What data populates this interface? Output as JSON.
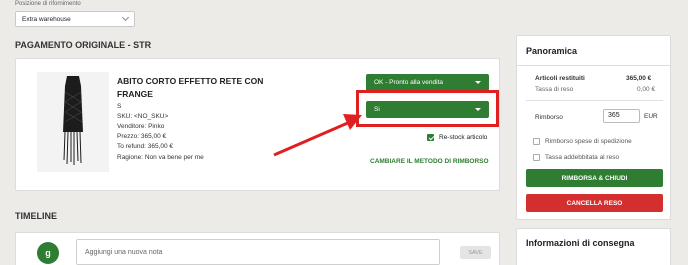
{
  "restock": {
    "label": "Posizione di rifornimento",
    "selected": "Extra warehouse"
  },
  "original_payment": {
    "title": "PAGAMENTO ORIGINALE - STR",
    "product": {
      "name": "ABITO CORTO EFFETTO RETE CON FRANGE",
      "size": "S",
      "sku": "SKU: <NO_SKU>",
      "seller_label": "Venditore:",
      "seller": "Pinko",
      "price_label": "Prezzo:",
      "price": "365,00 €",
      "refund_label": "To refund:",
      "refund": "365,00 €",
      "reason_label": "Ragione:",
      "reason": "Non va bene per me"
    },
    "status_select": "OK - Pronto alla vendita",
    "yes_select": "Si",
    "restock_item_label": "Re-stock articolo",
    "restock_item_checked": true,
    "change_refund_link": "CAMBIARE IL METODO DI RIMBORSO"
  },
  "timeline": {
    "title": "TIMELINE",
    "avatar_letter": "g",
    "note_placeholder": "Aggiungi una nuova nota",
    "save_label": "SAVE"
  },
  "overview": {
    "title": "Panoramica",
    "returned_items_label": "Articoli restituiti",
    "returned_items_value": "365,00 €",
    "return_fee_label": "Tassa di reso",
    "return_fee_value": "0,00 €",
    "refund_label": "Rimborso",
    "refund_value": "365",
    "currency": "EUR",
    "shipping_refund_label": "Rimborso spese di spedizione",
    "charged_fee_label": "Tassa addebbitata al reso",
    "refund_close_label": "RIMBORSA & CHIUDI",
    "cancel_return_label": "CANCELLA RESO"
  },
  "delivery": {
    "title": "Informazioni di consegna"
  },
  "colors": {
    "green": "#2e7d32",
    "red": "#d32f2f",
    "annotation": "#e02020"
  }
}
